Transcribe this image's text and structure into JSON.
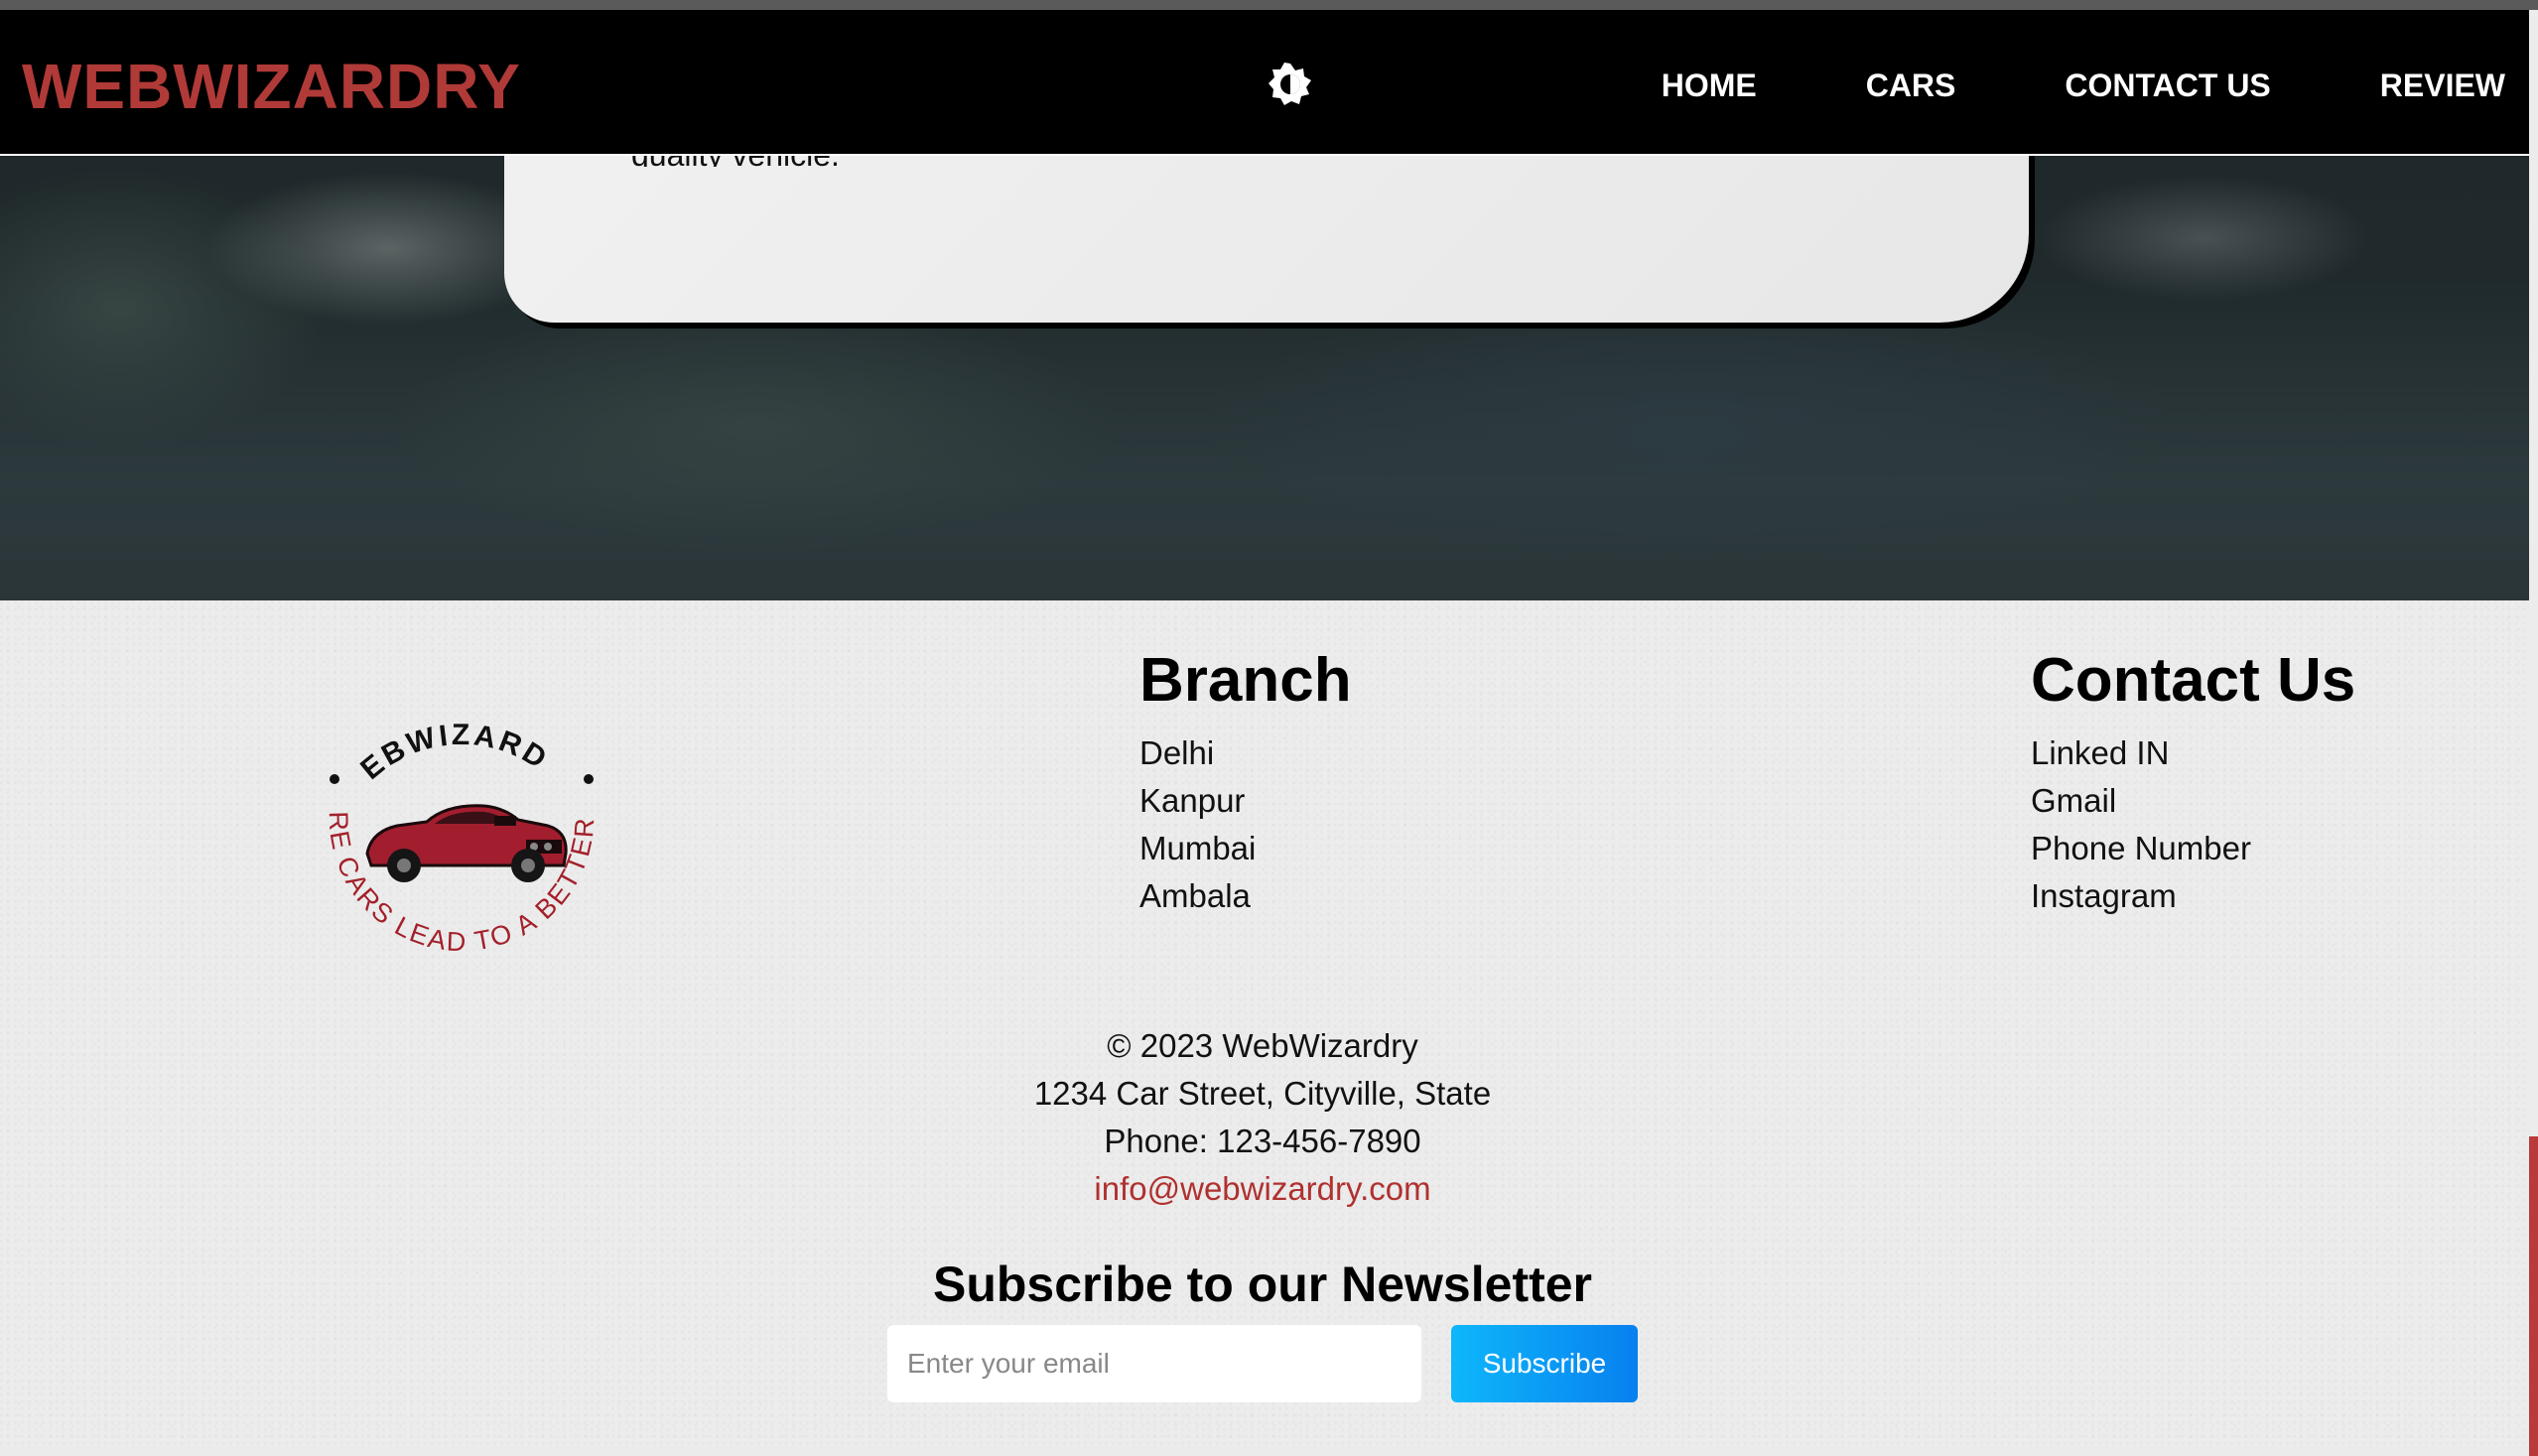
{
  "header": {
    "brand": "WEBWIZARDRY",
    "nav": [
      "HOME",
      "CARS",
      "CONTACT US",
      "REVIEW"
    ],
    "theme_toggle_icon": "brightness-icon"
  },
  "hero": {
    "card_text": "quality vehicle."
  },
  "footer": {
    "logo": {
      "top_text": "WEBWIZARDRY",
      "bottom_text": "WHERE CARS LEAD TO A BETTER LIFE",
      "icon": "car-icon"
    },
    "branch": {
      "title": "Branch",
      "items": [
        "Delhi",
        "Kanpur",
        "Mumbai",
        "Ambala"
      ]
    },
    "contact": {
      "title": "Contact Us",
      "items": [
        "Linked IN",
        "Gmail",
        "Phone Number",
        "Instagram"
      ]
    },
    "copyright": "© 2023 WebWizardry",
    "address": "1234 Car Street, Cityville, State",
    "phone": "Phone: 123-456-7890",
    "email": "info@webwizardry.com",
    "newsletter": {
      "title": "Subscribe to our Newsletter",
      "placeholder": "Enter your email",
      "button": "Subscribe"
    }
  },
  "colors": {
    "brand_red": "#b03a37",
    "link_red": "#b0312f",
    "subscribe_blue": "#0b9df5",
    "navbar_bg": "#000000",
    "footer_bg": "#ececec"
  }
}
